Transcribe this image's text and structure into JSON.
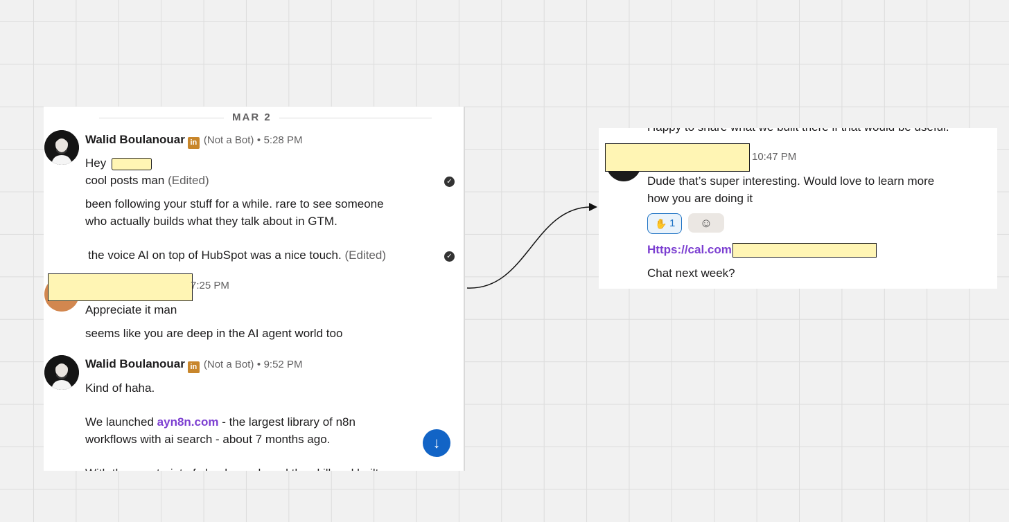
{
  "left_panel": {
    "date_divider": "MAR 2",
    "messages": [
      {
        "author": "Walid Boulanouar",
        "badge": "in",
        "tag": "(Not a Bot)",
        "separator": "•",
        "time": "5:28 PM",
        "greeting": "Hey",
        "line1": "cool posts man",
        "edited1": "(Edited)",
        "para2_line1": "been following your stuff for a while. rare to see someone",
        "para2_line2": "who actually builds what they talk about in GTM.",
        "para3": "the voice AI on top of HubSpot was a nice touch.",
        "edited2": "(Edited)"
      },
      {
        "time": "7:25 PM",
        "line1": "Appreciate it man",
        "line2": "seems like you are deep in the AI agent world too"
      },
      {
        "author": "Walid Boulanouar",
        "badge": "in",
        "tag": "(Not a Bot)",
        "separator": "•",
        "time": "9:52 PM",
        "line1": "Kind of haha.",
        "line2_prefix": "We launched ",
        "line2_link": "ayn8n.com",
        "line2_suffix": " - the largest library of n8n",
        "line3": "workflows with ai search - about 7 months ago.",
        "line4_cut": "With the constraint of cloud, we shared the skill and built"
      }
    ],
    "scroll_icon": "arrow-down-icon",
    "check_icon": "check-circle-icon"
  },
  "right_panel": {
    "top_cut": "Happy to share what we built there if that would be useful.",
    "time": "10:47 PM",
    "line1": "Dude that’s super interesting. Would love to learn more",
    "line2": "how you are doing it",
    "reaction_emoji": "raised-hands-icon",
    "reaction_count": "1",
    "add_reaction_icon": "add-emoji-icon",
    "link_text": "Https://cal.com",
    "line3": "Chat next week?"
  },
  "colors": {
    "link": "#7c3fd1",
    "redaction": "#fff5b4",
    "scroll_button": "#1264c6",
    "linkedin_badge": "#c8862b"
  }
}
